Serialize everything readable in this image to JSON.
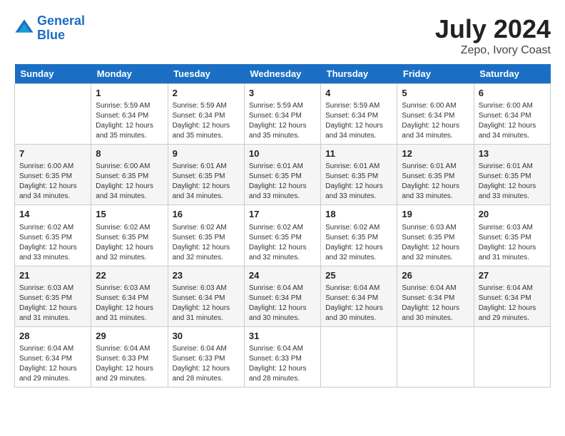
{
  "header": {
    "logo_line1": "General",
    "logo_line2": "Blue",
    "month_year": "July 2024",
    "location": "Zepo, Ivory Coast"
  },
  "days_of_week": [
    "Sunday",
    "Monday",
    "Tuesday",
    "Wednesday",
    "Thursday",
    "Friday",
    "Saturday"
  ],
  "weeks": [
    [
      {
        "day": "",
        "sunrise": "",
        "sunset": "",
        "daylight": ""
      },
      {
        "day": "1",
        "sunrise": "Sunrise: 5:59 AM",
        "sunset": "Sunset: 6:34 PM",
        "daylight": "Daylight: 12 hours and 35 minutes."
      },
      {
        "day": "2",
        "sunrise": "Sunrise: 5:59 AM",
        "sunset": "Sunset: 6:34 PM",
        "daylight": "Daylight: 12 hours and 35 minutes."
      },
      {
        "day": "3",
        "sunrise": "Sunrise: 5:59 AM",
        "sunset": "Sunset: 6:34 PM",
        "daylight": "Daylight: 12 hours and 35 minutes."
      },
      {
        "day": "4",
        "sunrise": "Sunrise: 5:59 AM",
        "sunset": "Sunset: 6:34 PM",
        "daylight": "Daylight: 12 hours and 34 minutes."
      },
      {
        "day": "5",
        "sunrise": "Sunrise: 6:00 AM",
        "sunset": "Sunset: 6:34 PM",
        "daylight": "Daylight: 12 hours and 34 minutes."
      },
      {
        "day": "6",
        "sunrise": "Sunrise: 6:00 AM",
        "sunset": "Sunset: 6:34 PM",
        "daylight": "Daylight: 12 hours and 34 minutes."
      }
    ],
    [
      {
        "day": "7",
        "sunrise": "Sunrise: 6:00 AM",
        "sunset": "Sunset: 6:35 PM",
        "daylight": "Daylight: 12 hours and 34 minutes."
      },
      {
        "day": "8",
        "sunrise": "Sunrise: 6:00 AM",
        "sunset": "Sunset: 6:35 PM",
        "daylight": "Daylight: 12 hours and 34 minutes."
      },
      {
        "day": "9",
        "sunrise": "Sunrise: 6:01 AM",
        "sunset": "Sunset: 6:35 PM",
        "daylight": "Daylight: 12 hours and 34 minutes."
      },
      {
        "day": "10",
        "sunrise": "Sunrise: 6:01 AM",
        "sunset": "Sunset: 6:35 PM",
        "daylight": "Daylight: 12 hours and 33 minutes."
      },
      {
        "day": "11",
        "sunrise": "Sunrise: 6:01 AM",
        "sunset": "Sunset: 6:35 PM",
        "daylight": "Daylight: 12 hours and 33 minutes."
      },
      {
        "day": "12",
        "sunrise": "Sunrise: 6:01 AM",
        "sunset": "Sunset: 6:35 PM",
        "daylight": "Daylight: 12 hours and 33 minutes."
      },
      {
        "day": "13",
        "sunrise": "Sunrise: 6:01 AM",
        "sunset": "Sunset: 6:35 PM",
        "daylight": "Daylight: 12 hours and 33 minutes."
      }
    ],
    [
      {
        "day": "14",
        "sunrise": "Sunrise: 6:02 AM",
        "sunset": "Sunset: 6:35 PM",
        "daylight": "Daylight: 12 hours and 33 minutes."
      },
      {
        "day": "15",
        "sunrise": "Sunrise: 6:02 AM",
        "sunset": "Sunset: 6:35 PM",
        "daylight": "Daylight: 12 hours and 32 minutes."
      },
      {
        "day": "16",
        "sunrise": "Sunrise: 6:02 AM",
        "sunset": "Sunset: 6:35 PM",
        "daylight": "Daylight: 12 hours and 32 minutes."
      },
      {
        "day": "17",
        "sunrise": "Sunrise: 6:02 AM",
        "sunset": "Sunset: 6:35 PM",
        "daylight": "Daylight: 12 hours and 32 minutes."
      },
      {
        "day": "18",
        "sunrise": "Sunrise: 6:02 AM",
        "sunset": "Sunset: 6:35 PM",
        "daylight": "Daylight: 12 hours and 32 minutes."
      },
      {
        "day": "19",
        "sunrise": "Sunrise: 6:03 AM",
        "sunset": "Sunset: 6:35 PM",
        "daylight": "Daylight: 12 hours and 32 minutes."
      },
      {
        "day": "20",
        "sunrise": "Sunrise: 6:03 AM",
        "sunset": "Sunset: 6:35 PM",
        "daylight": "Daylight: 12 hours and 31 minutes."
      }
    ],
    [
      {
        "day": "21",
        "sunrise": "Sunrise: 6:03 AM",
        "sunset": "Sunset: 6:35 PM",
        "daylight": "Daylight: 12 hours and 31 minutes."
      },
      {
        "day": "22",
        "sunrise": "Sunrise: 6:03 AM",
        "sunset": "Sunset: 6:34 PM",
        "daylight": "Daylight: 12 hours and 31 minutes."
      },
      {
        "day": "23",
        "sunrise": "Sunrise: 6:03 AM",
        "sunset": "Sunset: 6:34 PM",
        "daylight": "Daylight: 12 hours and 31 minutes."
      },
      {
        "day": "24",
        "sunrise": "Sunrise: 6:04 AM",
        "sunset": "Sunset: 6:34 PM",
        "daylight": "Daylight: 12 hours and 30 minutes."
      },
      {
        "day": "25",
        "sunrise": "Sunrise: 6:04 AM",
        "sunset": "Sunset: 6:34 PM",
        "daylight": "Daylight: 12 hours and 30 minutes."
      },
      {
        "day": "26",
        "sunrise": "Sunrise: 6:04 AM",
        "sunset": "Sunset: 6:34 PM",
        "daylight": "Daylight: 12 hours and 30 minutes."
      },
      {
        "day": "27",
        "sunrise": "Sunrise: 6:04 AM",
        "sunset": "Sunset: 6:34 PM",
        "daylight": "Daylight: 12 hours and 29 minutes."
      }
    ],
    [
      {
        "day": "28",
        "sunrise": "Sunrise: 6:04 AM",
        "sunset": "Sunset: 6:34 PM",
        "daylight": "Daylight: 12 hours and 29 minutes."
      },
      {
        "day": "29",
        "sunrise": "Sunrise: 6:04 AM",
        "sunset": "Sunset: 6:33 PM",
        "daylight": "Daylight: 12 hours and 29 minutes."
      },
      {
        "day": "30",
        "sunrise": "Sunrise: 6:04 AM",
        "sunset": "Sunset: 6:33 PM",
        "daylight": "Daylight: 12 hours and 28 minutes."
      },
      {
        "day": "31",
        "sunrise": "Sunrise: 6:04 AM",
        "sunset": "Sunset: 6:33 PM",
        "daylight": "Daylight: 12 hours and 28 minutes."
      },
      {
        "day": "",
        "sunrise": "",
        "sunset": "",
        "daylight": ""
      },
      {
        "day": "",
        "sunrise": "",
        "sunset": "",
        "daylight": ""
      },
      {
        "day": "",
        "sunrise": "",
        "sunset": "",
        "daylight": ""
      }
    ]
  ]
}
